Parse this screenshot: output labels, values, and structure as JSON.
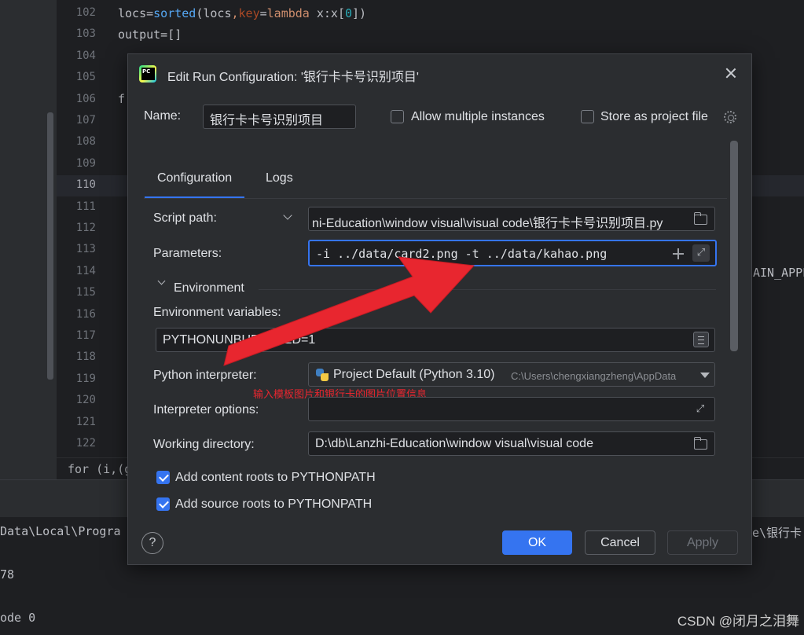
{
  "editor": {
    "line_numbers": [
      "102",
      "103",
      "104",
      "105",
      "106",
      "107",
      "108",
      "109",
      "110",
      "111",
      "112",
      "113",
      "114",
      "115",
      "116",
      "117",
      "118",
      "119",
      "120",
      "121",
      "122"
    ],
    "current_line": "110",
    "line_102": {
      "a": "locs",
      "b": "=",
      "c": "sorted",
      "d": "(locs",
      "e": ",",
      "f": "key",
      "g": "=",
      "h": "lambda",
      "i": " x:x[",
      "j": "0",
      "k": "])"
    },
    "line_103": "output=[]",
    "line_106_frag": "f",
    "right_frag": "AIN_APPE",
    "breadcrumb": "for (i,(gX,g"
  },
  "console": {
    "line1_left": "Data\\Local\\Progra",
    "line1_right": "e\\银行卡",
    "line2": "78",
    "line3": "ode 0"
  },
  "watermark": "CSDN @闭月之泪舞",
  "dialog": {
    "title": "Edit Run Configuration: '银行卡卡号识别项目'",
    "name_label": "Name:",
    "name_value": "银行卡卡号识别项目",
    "allow_multiple_label": "Allow multiple instances",
    "allow_multiple_checked": false,
    "store_as_project_label": "Store as project file",
    "store_as_project_checked": false,
    "tabs": [
      {
        "label": "Configuration",
        "active": true
      },
      {
        "label": "Logs",
        "active": false
      }
    ],
    "script_path_label": "Script path:",
    "script_path_value": "ni-Education\\window visual\\visual code\\银行卡卡号识别项目.py",
    "parameters_label": "Parameters:",
    "parameters_value": "-i ../data/card2.png -t ../data/kahao.png",
    "environment_label": "Environment",
    "env_vars_label": "Environment variables:",
    "env_vars_value": "PYTHONUNBUFFERED=1",
    "interpreter_label": "Python interpreter:",
    "interpreter_value": "Project Default (Python 3.10)",
    "interpreter_path": "C:\\Users\\chengxiangzheng\\AppData",
    "annotation": "输入模板图片和银行卡的图片位置信息",
    "interpreter_options_label": "Interpreter options:",
    "interpreter_options_value": "",
    "working_dir_label": "Working directory:",
    "working_dir_value": "D:\\db\\Lanzhi-Education\\window visual\\visual code",
    "add_content_roots_label": "Add content roots to PYTHONPATH",
    "add_content_roots_checked": true,
    "add_source_roots_label": "Add source roots to PYTHONPATH",
    "add_source_roots_checked": true,
    "help_label": "?",
    "ok_label": "OK",
    "cancel_label": "Cancel",
    "apply_label": "Apply"
  },
  "colors": {
    "accent": "#3574f0",
    "dialog_bg": "#2b2d30",
    "editor_bg": "#1e1f22",
    "arrow_red": "#e8262f"
  }
}
